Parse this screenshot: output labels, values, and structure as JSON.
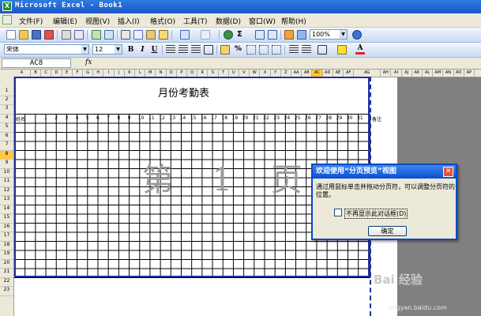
{
  "window": {
    "title": "Microsoft Excel - Book1",
    "app_icon": "excel-icon"
  },
  "menu": [
    "文件(F)",
    "编辑(E)",
    "视图(V)",
    "插入(I)",
    "格式(O)",
    "工具(T)",
    "数据(D)",
    "窗口(W)",
    "帮助(H)"
  ],
  "toolbar": {
    "zoom": "100%",
    "font_name": "宋体",
    "font_size": "12",
    "bold": "B",
    "italic": "I",
    "underline": "U",
    "percent": "%",
    "sigma": "Σ",
    "icons": [
      "new-icon",
      "open-icon",
      "save-icon",
      "permission-icon",
      "print-icon",
      "print-preview-icon",
      "spelling-icon",
      "research-icon",
      "cut-icon",
      "copy-icon",
      "paste-icon",
      "format-painter-icon",
      "undo-icon",
      "redo-icon",
      "hyperlink-icon",
      "autosum-icon",
      "sort-ascending-icon",
      "sort-descending-icon",
      "chart-wizard-icon",
      "drawing-icon",
      "help-icon"
    ]
  },
  "formula_bar": {
    "name_box": "AC8",
    "fx": "fx"
  },
  "columns": [
    "A",
    "B",
    "C",
    "D",
    "E",
    "F",
    "G",
    "H",
    "I",
    "J",
    "K",
    "L",
    "M",
    "N",
    "O",
    "P",
    "Q",
    "R",
    "S",
    "T",
    "U",
    "V",
    "W",
    "X",
    "Y",
    "Z",
    "AA",
    "AB",
    "AC",
    "AD",
    "AE",
    "AF",
    "AG",
    "AH",
    "AI",
    "AJ",
    "AK",
    "AL",
    "AM",
    "AN",
    "AO",
    "AP"
  ],
  "rows": [
    "1",
    "2",
    "3",
    "4",
    "5",
    "6",
    "7",
    "8",
    "9",
    "10",
    "11",
    "12",
    "13",
    "14",
    "15",
    "16",
    "17",
    "18",
    "19",
    "20",
    "21",
    "22",
    "23"
  ],
  "sheet": {
    "title": "月份考勤表",
    "name_header": "姓名",
    "days": [
      "1",
      "2",
      "3",
      "4",
      "5",
      "6",
      "7",
      "8",
      "9",
      "10",
      "11",
      "12",
      "13",
      "14",
      "15",
      "16",
      "17",
      "18",
      "19",
      "20",
      "21",
      "22",
      "23",
      "24",
      "25",
      "26",
      "27",
      "28",
      "29",
      "30",
      "31"
    ],
    "remark_header": "备注",
    "page_watermark": "第 1 页"
  },
  "dialog": {
    "title": "欢迎使用“分页预览”视图",
    "message": "通过用鼠标单击并拖动分页符，可以调整分页符的位置。",
    "checkbox_label": "不再显示此对话框(D)",
    "checkbox_checked": false,
    "ok_label": "确定",
    "close": "✕"
  },
  "overlay": {
    "brand": "Bai 经验",
    "url": "jingyan.baidu.com"
  }
}
